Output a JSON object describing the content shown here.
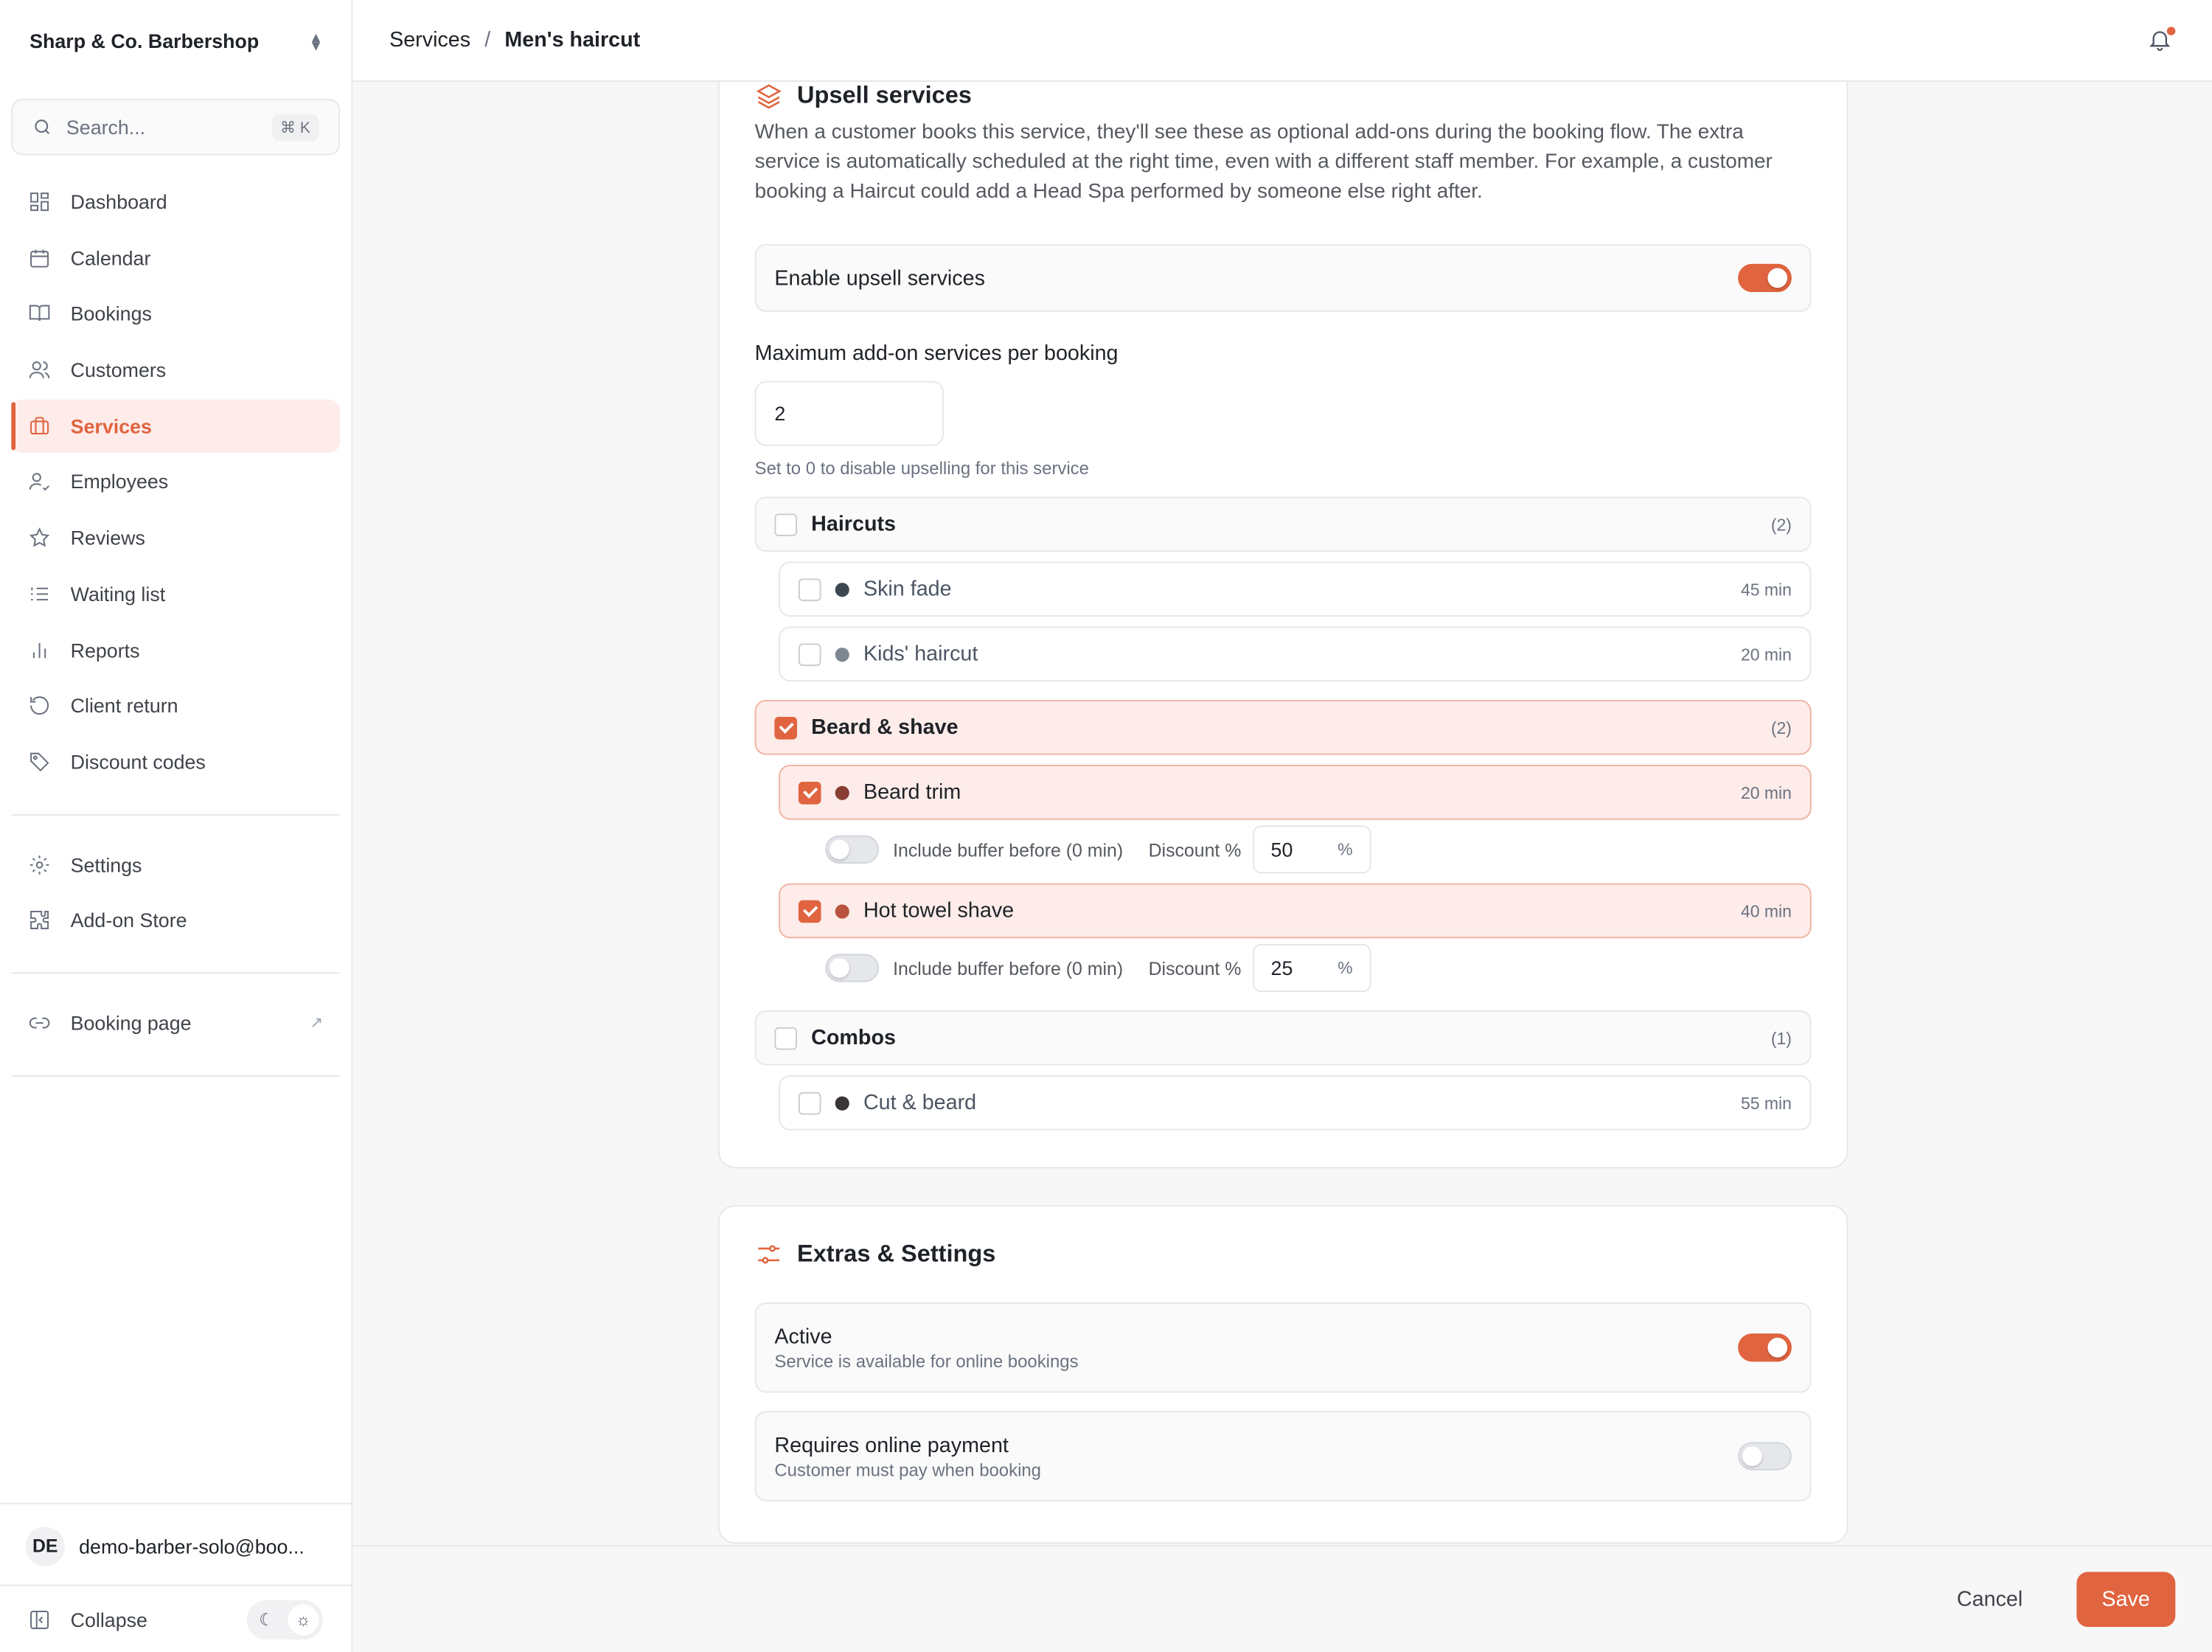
{
  "org": {
    "name": "Sharp & Co. Barbershop"
  },
  "search": {
    "placeholder": "Search...",
    "shortcut": "⌘ K"
  },
  "sidebar": {
    "items": [
      {
        "label": "Dashboard",
        "icon": "dashboard-icon"
      },
      {
        "label": "Calendar",
        "icon": "calendar-icon"
      },
      {
        "label": "Bookings",
        "icon": "book-icon"
      },
      {
        "label": "Customers",
        "icon": "users-icon"
      },
      {
        "label": "Services",
        "icon": "briefcase-icon",
        "active": true
      },
      {
        "label": "Employees",
        "icon": "user-check-icon"
      },
      {
        "label": "Reviews",
        "icon": "star-icon"
      },
      {
        "label": "Waiting list",
        "icon": "list-icon"
      },
      {
        "label": "Reports",
        "icon": "bar-chart-icon"
      },
      {
        "label": "Client return",
        "icon": "rotate-icon"
      },
      {
        "label": "Discount codes",
        "icon": "tag-icon"
      }
    ],
    "secondary": [
      {
        "label": "Settings",
        "icon": "gear-icon"
      },
      {
        "label": "Add-on Store",
        "icon": "puzzle-icon"
      }
    ],
    "booking_page": {
      "label": "Booking page",
      "icon": "link-icon"
    },
    "user": {
      "initials": "DE",
      "email": "demo-barber-solo@boo..."
    },
    "collapse_label": "Collapse"
  },
  "breadcrumb": {
    "parent": "Services",
    "separator": "/",
    "current": "Men's haircut"
  },
  "upsell": {
    "title": "Upsell services",
    "description": "When a customer books this service, they'll see these as optional add-ons during the booking flow. The extra service is automatically scheduled at the right time, even with a different staff member. For example, a customer booking a Haircut could add a Head Spa performed by someone else right after.",
    "enable_label": "Enable upsell services",
    "enabled": true,
    "max_label": "Maximum add-on services per booking",
    "max_value": "2",
    "max_hint": "Set to 0 to disable upselling for this service",
    "groups": [
      {
        "name": "Haircuts",
        "count": "(2)",
        "checked": false,
        "items": [
          {
            "name": "Skin fade",
            "duration": "45 min",
            "color": "#3d4752",
            "checked": false
          },
          {
            "name": "Kids' haircut",
            "duration": "20 min",
            "color": "#7d8791",
            "checked": false
          }
        ]
      },
      {
        "name": "Beard & shave",
        "count": "(2)",
        "checked": true,
        "items": [
          {
            "name": "Beard trim",
            "duration": "20 min",
            "color": "#8a3e33",
            "checked": true,
            "buffer_label": "Include buffer before (0 min)",
            "discount_label": "Discount %",
            "discount": "50",
            "pct": "%"
          },
          {
            "name": "Hot towel shave",
            "duration": "40 min",
            "color": "#b9523e",
            "checked": true,
            "buffer_label": "Include buffer before (0 min)",
            "discount_label": "Discount %",
            "discount": "25",
            "pct": "%"
          }
        ]
      },
      {
        "name": "Combos",
        "count": "(1)",
        "checked": false,
        "items": [
          {
            "name": "Cut & beard",
            "duration": "55 min",
            "color": "#3a3436",
            "checked": false
          }
        ]
      }
    ]
  },
  "extras": {
    "title": "Extras & Settings",
    "active": {
      "title": "Active",
      "subtitle": "Service is available for online bookings",
      "on": true
    },
    "payment": {
      "title": "Requires online payment",
      "subtitle": "Customer must pay when booking",
      "on": false
    }
  },
  "footer": {
    "cancel": "Cancel",
    "save": "Save"
  },
  "colors": {
    "accent": "#e0643f",
    "accent_soft": "#fdecea"
  }
}
